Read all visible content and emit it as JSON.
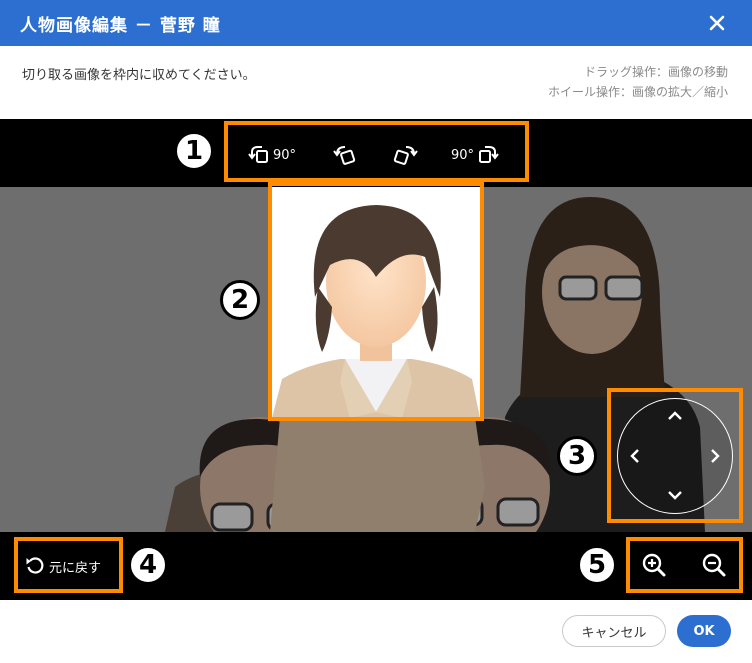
{
  "dialog": {
    "title": "人物画像編集 － 菅野 瞳",
    "instruction": "切り取る画像を枠内に収めてください。",
    "hint_drag": "ドラッグ操作：画像の移動",
    "hint_wheel": "ホイール操作：画像の拡大／縮小"
  },
  "toolbar": {
    "rotate_left_90_label": "90°",
    "rotate_right_90_label": "90°"
  },
  "badges": [
    "1",
    "2",
    "3",
    "4",
    "5"
  ],
  "reset": {
    "label": "元に戻す"
  },
  "footer": {
    "cancel_label": "キャンセル",
    "ok_label": "OK"
  },
  "colors": {
    "title_bar": "#2d6fd0",
    "highlight": "#ff8c00",
    "ok_button": "#2d6fd0",
    "bar": "#000000"
  },
  "icons": [
    "close-icon",
    "rotate-left-90-icon",
    "rotate-left-icon",
    "rotate-right-icon",
    "rotate-right-90-icon",
    "reset-icon",
    "zoom-in-icon",
    "zoom-out-icon",
    "chevron-up-icon",
    "chevron-down-icon",
    "chevron-left-icon",
    "chevron-right-icon"
  ]
}
